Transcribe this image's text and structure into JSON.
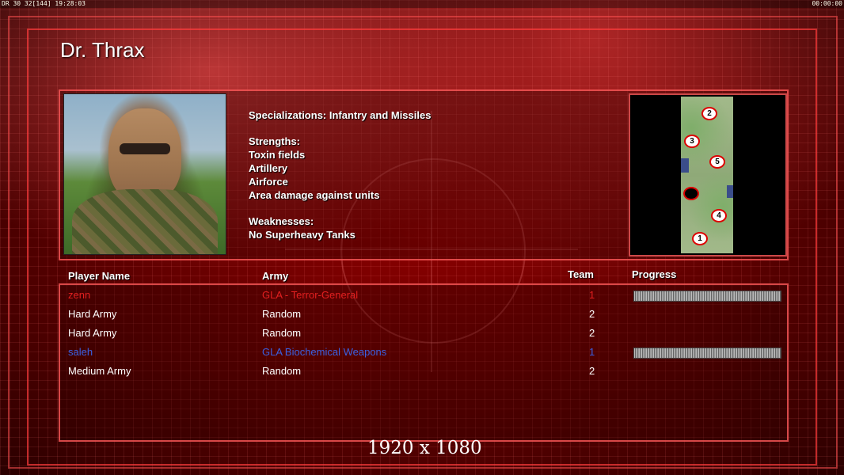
{
  "hud": {
    "left_text": "DR 30 32[144] 19:28:03",
    "right_text": "00:00:00"
  },
  "general": {
    "name": "Dr. Thrax"
  },
  "specs": {
    "specialization": "Specializations: Infantry and Missiles",
    "strengths_label": "Strengths:",
    "strengths": [
      "Toxin fields",
      "Artillery",
      "Airforce",
      "Area damage against units"
    ],
    "weaknesses_label": "Weaknesses:",
    "weaknesses": [
      "No Superheavy Tanks"
    ]
  },
  "map": {
    "markers": [
      {
        "label": "2"
      },
      {
        "label": "3"
      },
      {
        "label": "5"
      },
      {
        "label": ""
      },
      {
        "label": "4"
      },
      {
        "label": "1"
      }
    ]
  },
  "table": {
    "headers": {
      "player": "Player Name",
      "army": "Army",
      "team": "Team",
      "progress": "Progress"
    },
    "rows": [
      {
        "player": "zenn",
        "army": "GLA - Terror-General",
        "team": "1",
        "color": "red",
        "progress": 1
      },
      {
        "player": "Hard Army",
        "army": "Random",
        "team": "2",
        "color": "white",
        "progress": null
      },
      {
        "player": "Hard Army",
        "army": "Random",
        "team": "2",
        "color": "white",
        "progress": null
      },
      {
        "player": "saleh",
        "army": "GLA Biochemical Weapons",
        "team": "1",
        "color": "blue",
        "progress": 1
      },
      {
        "player": "Medium Army",
        "army": "Random",
        "team": "2",
        "color": "white",
        "progress": null
      }
    ]
  },
  "footer": {
    "resolution": "1920 x 1080"
  }
}
